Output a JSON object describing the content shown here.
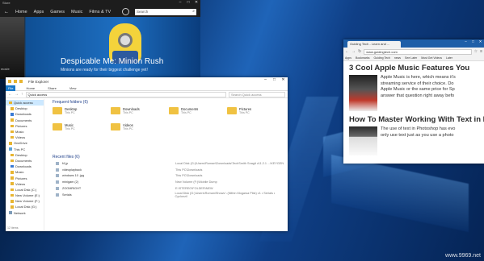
{
  "store": {
    "title": "Store",
    "back": "←",
    "tabs": [
      "Home",
      "Apps",
      "Games",
      "Music",
      "Films & TV"
    ],
    "search_placeholder": "Search",
    "window_controls": [
      "–",
      "□",
      "✕"
    ],
    "hero_left_label": "movie",
    "hero_title": "Despicable Me: Minion Rush",
    "hero_subtitle": "Minions are ready for their biggest challenge yet!"
  },
  "explorer": {
    "title": "File Explorer",
    "window_controls": [
      "–",
      "□",
      "✕"
    ],
    "ribbon_tabs": [
      "File",
      "Home",
      "Share",
      "View"
    ],
    "path": "Quick access",
    "search_placeholder": "Search Quick access",
    "nav": [
      {
        "label": "Quick access",
        "icon": "star-icon",
        "selected": true,
        "child": false
      },
      {
        "label": "Desktop",
        "icon": "folder-icon",
        "child": true
      },
      {
        "label": "Downloads",
        "icon": "download-icon",
        "child": true
      },
      {
        "label": "Documents",
        "icon": "folder-icon",
        "child": true
      },
      {
        "label": "Pictures",
        "icon": "folder-icon",
        "child": true
      },
      {
        "label": "Music",
        "icon": "folder-icon",
        "child": true
      },
      {
        "label": "Videos",
        "icon": "folder-icon",
        "child": true
      },
      {
        "label": "OneDrive",
        "icon": "cloud-icon",
        "child": false
      },
      {
        "label": "This PC",
        "icon": "pc-icon",
        "child": false
      },
      {
        "label": "Desktop",
        "icon": "folder-icon",
        "child": true
      },
      {
        "label": "Documents",
        "icon": "folder-icon",
        "child": true
      },
      {
        "label": "Downloads",
        "icon": "download-icon",
        "child": true
      },
      {
        "label": "Music",
        "icon": "folder-icon",
        "child": true
      },
      {
        "label": "Pictures",
        "icon": "folder-icon",
        "child": true
      },
      {
        "label": "Videos",
        "icon": "folder-icon",
        "child": true
      },
      {
        "label": "Local Disk (C:)",
        "icon": "drive-icon",
        "child": true
      },
      {
        "label": "New Volume (E:)",
        "icon": "drive-icon",
        "child": true
      },
      {
        "label": "New Volume (F:)",
        "icon": "drive-icon",
        "child": true
      },
      {
        "label": "Local Disk (G:)",
        "icon": "drive-icon",
        "child": true
      },
      {
        "label": "Network",
        "icon": "network-icon",
        "child": false
      }
    ],
    "frequent_heading": "Frequent folders (6)",
    "frequent": [
      {
        "name": "Desktop",
        "sub": "This PC"
      },
      {
        "name": "Downloads",
        "sub": "This PC"
      },
      {
        "name": "Documents",
        "sub": "This PC"
      },
      {
        "name": "Pictures",
        "sub": "This PC"
      },
      {
        "name": "Music",
        "sub": "This PC"
      },
      {
        "name": "Videos",
        "sub": "This PC"
      }
    ],
    "recent_heading": "Recent files (6)",
    "recent": [
      {
        "name": "f4.jp",
        "path": "Local Disk (G:)\\Users\\Roman\\Downloads\\TechSmith Snagit v11.2.1 ...\\KEYGEN"
      },
      {
        "name": "videoplayback",
        "path": "This PC\\Downloads"
      },
      {
        "name": "windows 10 .jpg",
        "path": "This PC\\Downloads"
      },
      {
        "name": "minigam (2)",
        "path": "New Volume (F:)\\Mobile Dump"
      },
      {
        "name": "ZOOMRIGHT",
        "path": "E:\\STEREO\\FOLDER\\NEW"
      },
      {
        "name": "Serials",
        "path": "Local Disk (G:)\\Users\\Roman\\Shows \\ (Nithin Mogarsa Plist) v1 • Serials • Cyclonzil"
      }
    ],
    "status": "12 items"
  },
  "browser": {
    "tab_title": "Guiding Tech - Learn and ...",
    "window_controls": [
      "–",
      "□",
      "✕"
    ],
    "url": "www.guidingtech.com",
    "bookmarks": [
      "Apps",
      "Bookmarks",
      "Guiding Tech",
      "news",
      "See Later",
      "Must Get Videos",
      "Later"
    ],
    "article1_title": "3 Cool Apple Music Features You",
    "article1_lines": [
      "Apple Music is here, which means it's",
      "streaming service of their choice. Do",
      "Apple Music or the same price for Sp",
      "answer that question right away befo"
    ],
    "article2_title": "How To Master Working With Text in Ph",
    "article2_lines": [
      "The use of text in Photoshop has evo",
      "only use text just as you use a photo"
    ]
  },
  "watermark": "www.9969.net"
}
